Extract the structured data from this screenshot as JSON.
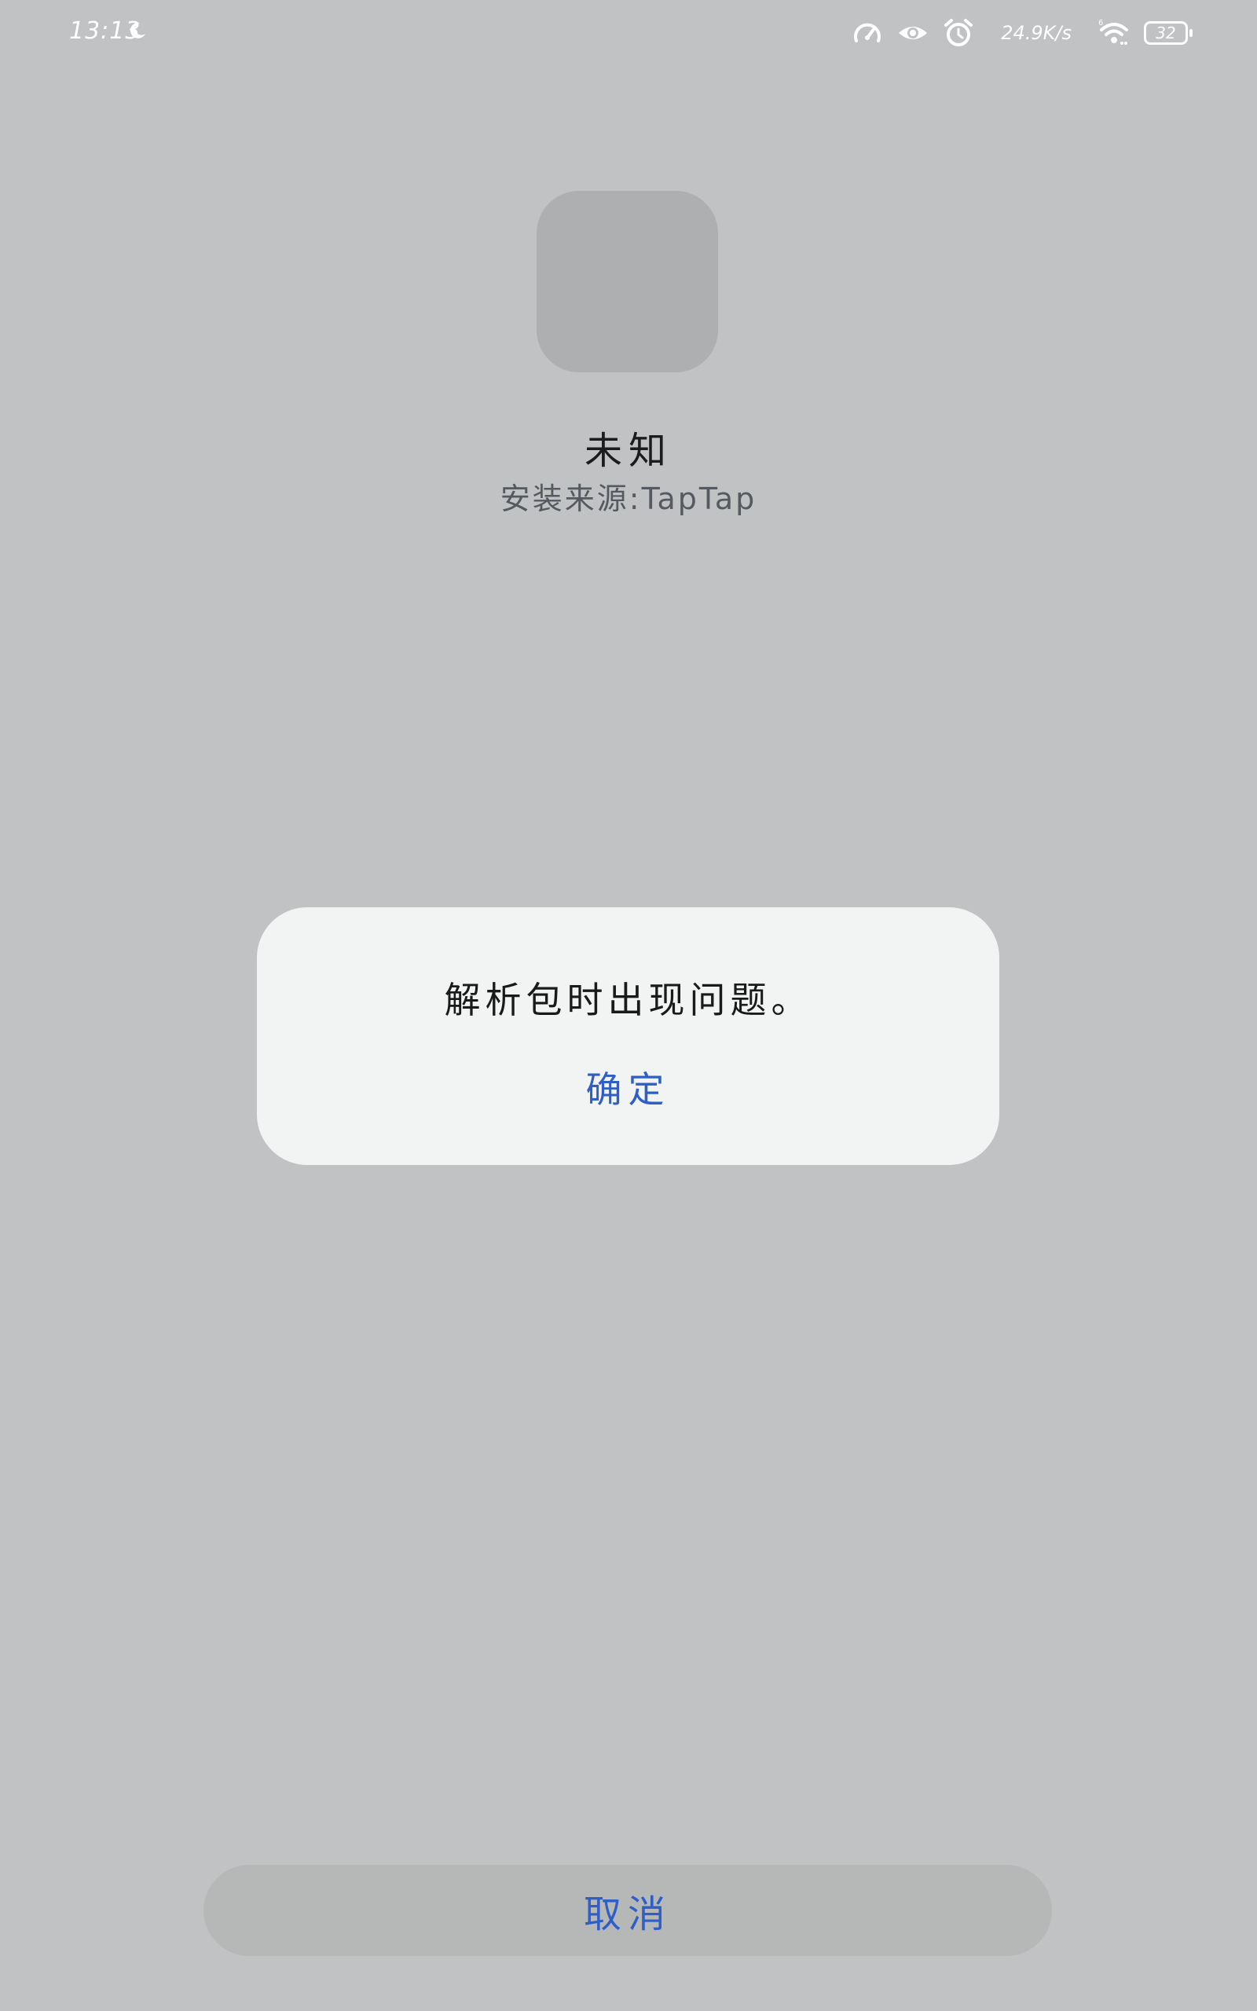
{
  "status_bar": {
    "time": "13:13",
    "net_speed": "24.9K/s",
    "signal_label": "6",
    "battery": "32",
    "icons": [
      "moon-icon",
      "speedometer-icon",
      "eye-icon",
      "alarm-icon",
      "wifi-icon",
      "battery-icon"
    ]
  },
  "app": {
    "name": "未知",
    "source": "安装来源:TapTap"
  },
  "dialog": {
    "message": "解析包时出现问题。",
    "confirm_label": "确定"
  },
  "footer": {
    "cancel_label": "取消"
  },
  "colors": {
    "background": "#c1c2c4",
    "dialog_background": "#f2f3f3",
    "accent": "#2f5ec7",
    "icon_placeholder": "#aeafb1",
    "cancel_button_background": "#b6b7b7"
  }
}
